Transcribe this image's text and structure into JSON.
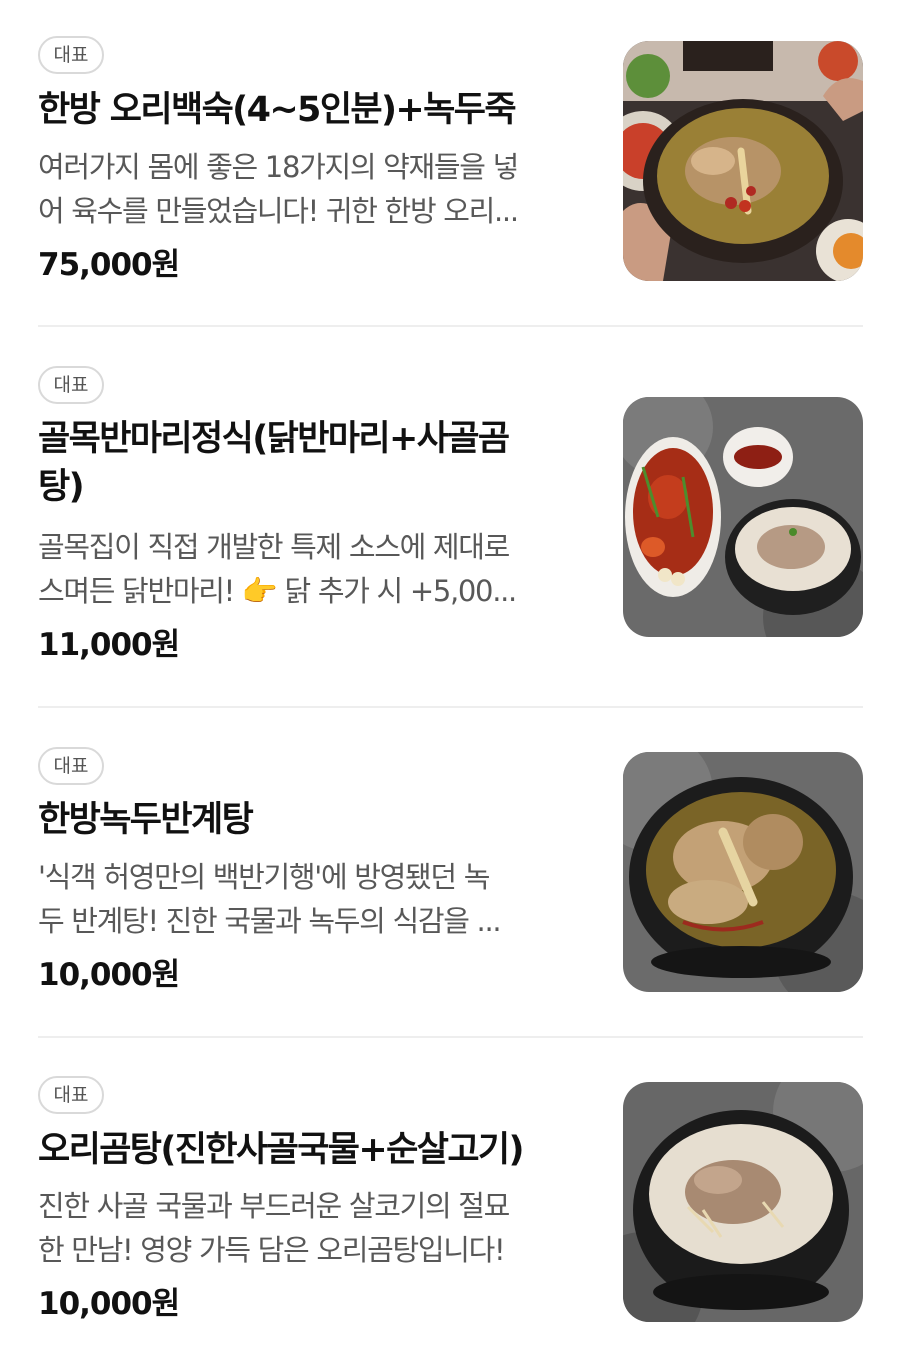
{
  "menu": [
    {
      "badge": "대표",
      "name": "한방 오리백숙(4~5인분)+녹두죽",
      "desc_line1": "여러가지 몸에 좋은 18가지의 약재들을 넣",
      "desc_line2": "어 육수를 만들었습니다! 귀한 한방 오리...",
      "price": "75,000원",
      "image_icon": "duck-herbal-soup-image"
    },
    {
      "badge": "대표",
      "name_line1": "골목반마리정식(닭반마리+사골곰",
      "name_line2": "탕)",
      "desc_line1": "골목집이 직접 개발한 특제 소스에 제대로",
      "desc_line2": "스며든 닭반마리! 👉 닭 추가 시 +5,00...",
      "price": "11,000원",
      "image_icon": "chicken-and-bone-soup-image"
    },
    {
      "badge": "대표",
      "name": "한방녹두반계탕",
      "desc_line1": "'식객 허영만의 백반기행'에 방영됐던 녹",
      "desc_line2": "두 반계탕! 진한 국물과 녹두의 식감을 ...",
      "price": "10,000원",
      "image_icon": "samgyetang-image"
    },
    {
      "badge": "대표",
      "name": "오리곰탕(진한사골국물+순살고기)",
      "desc_line1": "진한 사골 국물과 부드러운 살코기의 절묘",
      "desc_line2": "한 만남! 영양 가득 담은 오리곰탕입니다!",
      "price": "10,000원",
      "image_icon": "duck-gomtang-image"
    }
  ],
  "colors": {
    "text": "#111111",
    "description": "#585858",
    "badge_border": "#d9d9d9",
    "divider": "#eeeeee"
  }
}
